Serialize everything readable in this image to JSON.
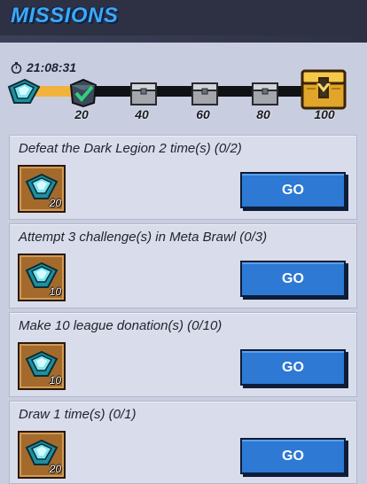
{
  "header": {
    "title": "MISSIONS"
  },
  "timer": {
    "text": "21:08:31",
    "icon": "stopwatch-icon"
  },
  "progress": {
    "fraction": 0.22,
    "checkpoints": [
      {
        "label": "20",
        "state": "claimed",
        "icon": "check-crate-icon"
      },
      {
        "label": "40",
        "state": "locked",
        "icon": "silver-crate-icon"
      },
      {
        "label": "60",
        "state": "locked",
        "icon": "silver-crate-icon"
      },
      {
        "label": "80",
        "state": "locked",
        "icon": "silver-crate-icon"
      },
      {
        "label": "100",
        "state": "locked",
        "icon": "gold-chest-icon"
      }
    ]
  },
  "missions": [
    {
      "title": "Defeat the Dark Legion 2 time(s)  (0/2)",
      "reward_qty": "20",
      "button": "GO"
    },
    {
      "title": "Attempt 3 challenge(s) in Meta Brawl  (0/3)",
      "reward_qty": "10",
      "button": "GO"
    },
    {
      "title": "Make 10 league donation(s)  (0/10)",
      "reward_qty": "10",
      "button": "GO"
    },
    {
      "title": "Draw 1 time(s)  (0/1)",
      "reward_qty": "20",
      "button": "GO"
    }
  ],
  "colors": {
    "accent_blue": "#2d79d4",
    "progress_fill": "#f2b33c",
    "title_blue": "#3fa8f5"
  }
}
